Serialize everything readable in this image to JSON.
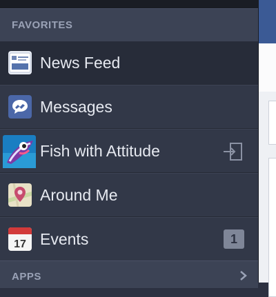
{
  "favorites_header": "FAVORITES",
  "apps_header": "APPS",
  "items": [
    {
      "label": "News Feed",
      "icon": "news-feed-icon",
      "selected": true
    },
    {
      "label": "Messages",
      "icon": "messages-icon"
    },
    {
      "label": "Fish with Attitude",
      "icon": "fish-app-icon",
      "action_icon": "exit-app-icon"
    },
    {
      "label": "Around Me",
      "icon": "map-pin-icon"
    },
    {
      "label": "Events",
      "icon": "calendar-icon",
      "badge": "1"
    }
  ],
  "calendar_day": "17",
  "colors": {
    "sidebar_bg": "#323848",
    "header_bg": "#3c4355",
    "selected_bg": "#272c39",
    "text": "#e6e9f0",
    "header_text": "#9aa2b6",
    "facebook_blue": "#3b5a95"
  }
}
